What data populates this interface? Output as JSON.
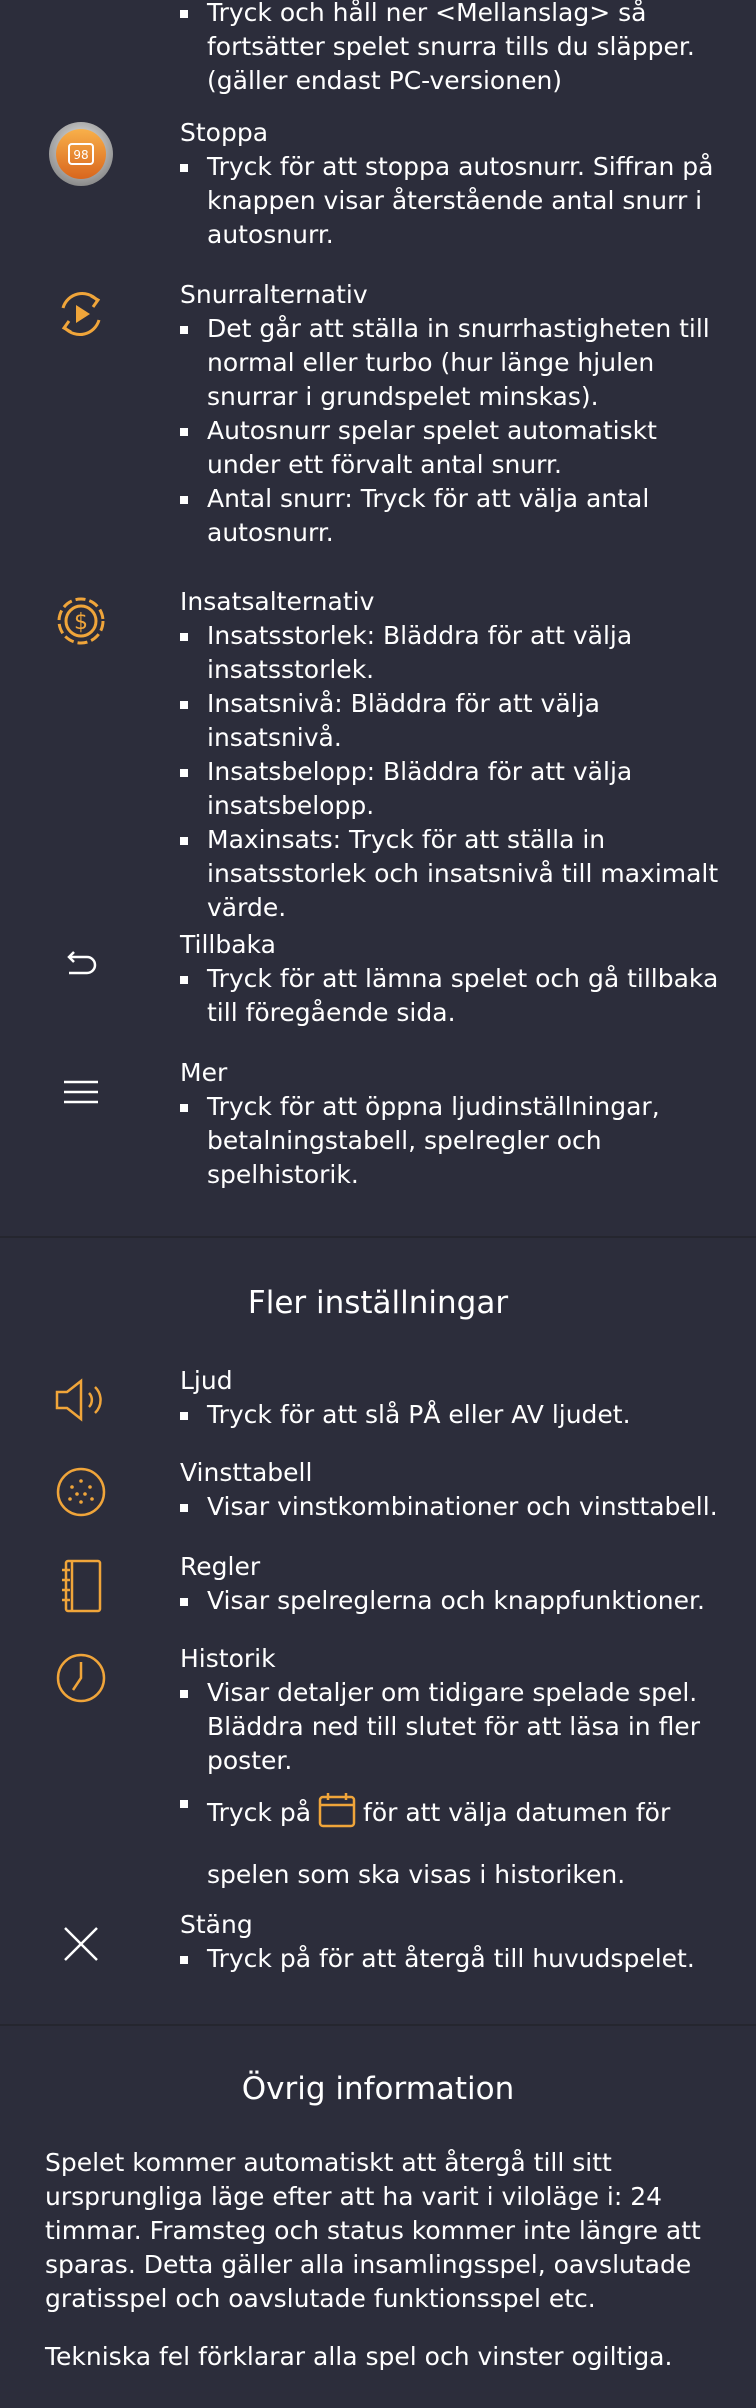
{
  "controls": {
    "spin_hold": {
      "bullets": [
        "Tryck och håll ner <Mellanslag> så fortsätter spelet snurra tills du släpper. (gäller endast PC-versionen)"
      ]
    },
    "stop": {
      "title": "Stoppa",
      "icon": "stop-autospin-icon",
      "bullets": [
        "Tryck för att stoppa autosnurr. Siffran på knappen visar återstående antal snurr i autosnurr."
      ]
    },
    "spin_options": {
      "title": "Snurralternativ",
      "icon": "spin-options-icon",
      "bullets": [
        "Det går att ställa in snurrhastigheten till normal eller turbo (hur länge hjulen snurrar i grundspelet minskas).",
        "Autosnurr spelar spelet automatiskt under ett förvalt antal snurr.",
        "Antal snurr: Tryck för att välja antal autosnurr."
      ]
    },
    "bet_options": {
      "title": "Insatsalternativ",
      "icon": "bet-options-icon",
      "bullets": [
        "Insatsstorlek: Bläddra för att välja insatsstorlek.",
        "Insatsnivå: Bläddra för att välja insatsnivå.",
        "Insatsbelopp: Bläddra för att välja insatsbelopp.",
        "Maxinsats: Tryck för att ställa in insatsstorlek och insatsnivå till maximalt värde."
      ]
    },
    "back": {
      "title": "Tillbaka",
      "icon": "back-arrow-icon",
      "bullets": [
        "Tryck för att lämna spelet och gå tillbaka till föregående sida."
      ]
    },
    "more": {
      "title": "Mer",
      "icon": "menu-icon",
      "bullets": [
        "Tryck för att öppna ljudinställningar, betalningstabell, spelregler och spelhistorik."
      ]
    }
  },
  "more_settings": {
    "heading": "Fler inställningar",
    "sound": {
      "title": "Ljud",
      "icon": "speaker-icon",
      "bullets": [
        "Tryck för att slå PÅ eller AV ljudet."
      ]
    },
    "paytable": {
      "title": "Vinsttabell",
      "icon": "paytable-icon",
      "bullets": [
        "Visar vinstkombinationer och vinsttabell."
      ]
    },
    "rules": {
      "title": "Regler",
      "icon": "rules-book-icon",
      "bullets": [
        "Visar spelreglerna och knappfunktioner."
      ]
    },
    "history": {
      "title": "Historik",
      "icon": "clock-icon",
      "bullets": [
        "Visar detaljer om tidigare spelade spel. Bläddra ned till slutet för att läsa in fler poster."
      ],
      "date_bullet_before": "Tryck på",
      "date_bullet_after": "för att välja datumen för spelen som ska visas i historiken."
    },
    "close": {
      "title": "Stäng",
      "icon": "close-icon",
      "bullets": [
        "Tryck på för att återgå till huvudspelet."
      ]
    }
  },
  "other_info": {
    "heading": "Övrig information",
    "paragraphs": [
      "Spelet kommer automatiskt att återgå till sitt ursprungliga läge efter att ha varit i viloläge i: 24 timmar. Framsteg och status kommer inte längre att sparas. Detta gäller alla insamlingsspel, oavslutade gratisspel och oavslutade funktionsspel etc.",
      "Tekniska fel förklarar alla spel och vinster ogiltiga."
    ]
  },
  "colors": {
    "background": "#2c2d3b",
    "accent": "#f0a53a",
    "text": "#ffffff",
    "divider": "#25262f"
  }
}
